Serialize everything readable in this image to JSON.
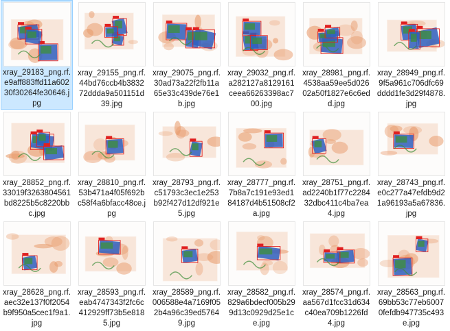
{
  "files": [
    {
      "name": "xray_29183_png.rf.e9aff883ffd11a60230f30264fe30646.jpg",
      "selected": true
    },
    {
      "name": "xray_29155_png.rf.44bd76ccb4b383272ddda9a501151d39.jpg"
    },
    {
      "name": "xray_29075_png.rf.30ad73a22f2fb11a65e33c439de76e1b.jpg"
    },
    {
      "name": "xray_29032_png.rf.a282127a8129161ceea66263398ac700.jpg"
    },
    {
      "name": "xray_28981_png.rf.4538aa59ee5d02602a50f1827e6c6edd.jpg"
    },
    {
      "name": "xray_28949_png.rf.9f5a961c706dfc69dddd1fe3d29f4878.jpg"
    },
    {
      "name": "xray_28852_png.rf.33019f3263804561bd8225b5c8220bbc.jpg"
    },
    {
      "name": "xray_28810_png.rf.53b471a4f05f692bc58f4a6bfacc48ce.jpg"
    },
    {
      "name": "xray_28793_png.rf.c51793c3ec1e253b92f427d12df921e5.jpg"
    },
    {
      "name": "xray_28777_png.rf.7b8a7c191e93ed184187d4b51508cf2a.jpg"
    },
    {
      "name": "xray_28751_png.rf.ad2240b1f77c228432dbc411c4ba7ea4.jpg"
    },
    {
      "name": "xray_28743_png.rf.e0c277a47efdb9d21a96193a5a67836.jpg"
    },
    {
      "name": "xray_28628_png.rf.aec32e137f0f2054b9f950a5cec1f9a1.jpg"
    },
    {
      "name": "xray_28593_png.rf.eab4747343f2fc6c412929ff73b5e8185.jpg"
    },
    {
      "name": "xray_28589_png.rf.006588e4a7169f052b4a96c39ed57649.jpg"
    },
    {
      "name": "xray_28582_png.rf.829a6bdecf005b299d13c0929d25e1ce.jpg"
    },
    {
      "name": "xray_28574_png.rf.aa567d1fcc31d634c40ea709b1226fd4.jpg"
    },
    {
      "name": "xray_28563_png.rf.69bb53c77eb60070fefdb947735c493e.jpg"
    }
  ],
  "colors": {
    "selection_bg": "#cce8ff",
    "selection_border": "#99d1ff",
    "xray_orange": "#e89a6a",
    "xray_blue": "#2f5fbf",
    "xray_green": "#3e8f3a",
    "annotation_red": "#e02020"
  }
}
